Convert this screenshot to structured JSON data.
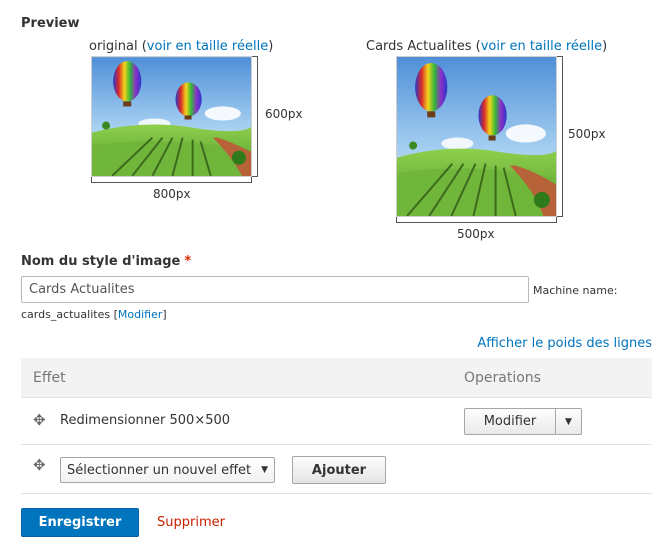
{
  "preview": {
    "title": "Preview",
    "original": {
      "caption_prefix": "original (",
      "link_label": "voir en taille réelle",
      "caption_suffix": ")",
      "height_label": "600px",
      "width_label": "800px"
    },
    "styled": {
      "caption_prefix": "Cards Actualites (",
      "link_label": "voir en taille réelle",
      "caption_suffix": ")",
      "height_label": "500px",
      "width_label": "500px"
    }
  },
  "name_field": {
    "label": "Nom du style d'image",
    "required_marker": "*",
    "value": "Cards Actualites",
    "machine_label": "Machine name:",
    "machine_value": "cards_actualites",
    "machine_bracket_open": "[",
    "machine_edit_link": "Modifier",
    "machine_bracket_close": "]"
  },
  "effects": {
    "row_weights_link": "Afficher le poids des lignes",
    "headers": {
      "effect": "Effet",
      "operations": "Operations"
    },
    "rows": [
      {
        "label": "Redimensionner 500×500",
        "operation": "Modifier"
      }
    ],
    "new_effect": {
      "select_value": "Sélectionner un nouvel effet",
      "add_label": "Ajouter"
    }
  },
  "actions": {
    "save_label": "Enregistrer",
    "delete_label": "Supprimer"
  },
  "colors": {
    "link": "#0074bd",
    "primary_button": "#0074bd",
    "danger": "#c72100",
    "required": "#e32700"
  },
  "icons": {
    "drag": "drag-handle-icon",
    "dropdown": "chevron-down-icon"
  }
}
